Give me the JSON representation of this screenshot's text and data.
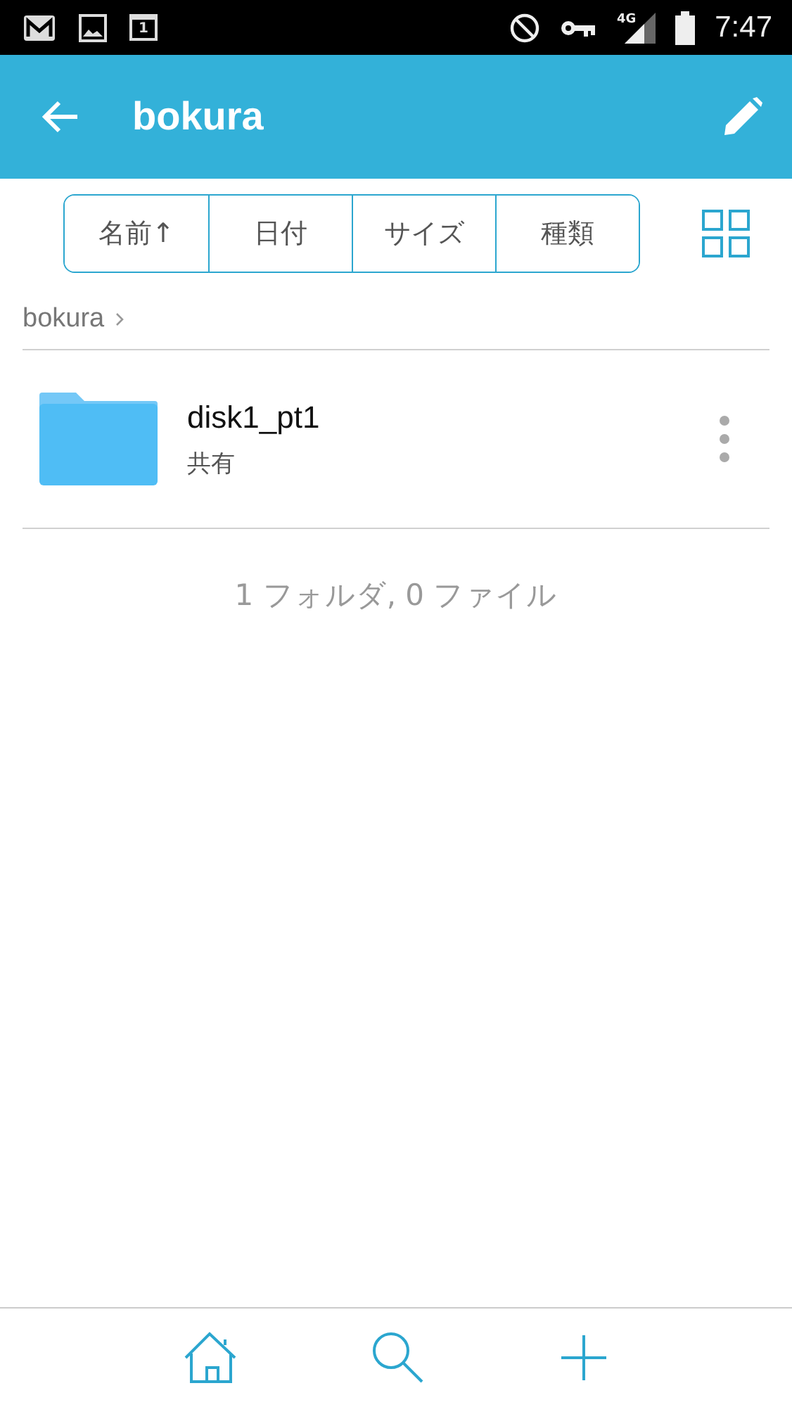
{
  "status_bar": {
    "calendar_day": "1",
    "network": "4G",
    "time": "7:47"
  },
  "app_bar": {
    "title": "bokura"
  },
  "sort_buttons": [
    {
      "label": "名前↑"
    },
    {
      "label": "日付"
    },
    {
      "label": "サイズ"
    },
    {
      "label": "種類"
    }
  ],
  "breadcrumb": [
    "bokura"
  ],
  "items": [
    {
      "kind": "folder",
      "name": "disk1_pt1",
      "subtitle": "共有"
    }
  ],
  "summary": "1 フォルダ, 0 ファイル"
}
